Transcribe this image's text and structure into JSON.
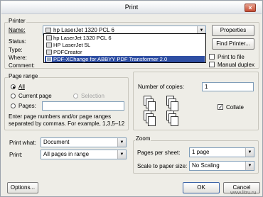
{
  "window": {
    "title": "Print",
    "close_glyph": "×"
  },
  "printer": {
    "group_label": "Printer",
    "name_label": "Name:",
    "selected": "hp LaserJet 1320 PCL 6",
    "status_label": "Status:",
    "type_label": "Type:",
    "where_label": "Where:",
    "comment_label": "Comment:",
    "properties_label": "Properties",
    "find_printer_label": "Find Printer...",
    "print_to_file_label": "Print to file",
    "manual_duplex_label": "Manual duplex",
    "options": [
      "hp LaserJet 1320 PCL 6",
      "HP LaserJet 5L",
      "PDFCreator",
      "PDF-XChange for ABBYY PDF Transformer 2.0"
    ],
    "highlighted_index": 3
  },
  "page_range": {
    "group_label": "Page range",
    "all_label": "All",
    "current_page_label": "Current page",
    "selection_label": "Selection",
    "pages_label": "Pages:",
    "pages_value": "",
    "hint_line1": "Enter page numbers and/or page ranges",
    "hint_line2": "separated by commas.  For example, 1,3,5–12"
  },
  "copies": {
    "number_label": "Number of copies:",
    "number_value": "1",
    "collate_label": "Collate",
    "collate_checked": true
  },
  "print_what": {
    "label": "Print what:",
    "value": "Document"
  },
  "print": {
    "label": "Print:",
    "value": "All pages in range"
  },
  "zoom": {
    "group_label": "Zoom",
    "pages_per_sheet_label": "Pages per sheet:",
    "pages_per_sheet_value": "1 page",
    "scale_label": "Scale to paper size:",
    "scale_value": "No Scaling"
  },
  "footer": {
    "options_label": "Options...",
    "ok_label": "OK",
    "cancel_label": "Cancel",
    "watermark": "www.litru.ru"
  }
}
